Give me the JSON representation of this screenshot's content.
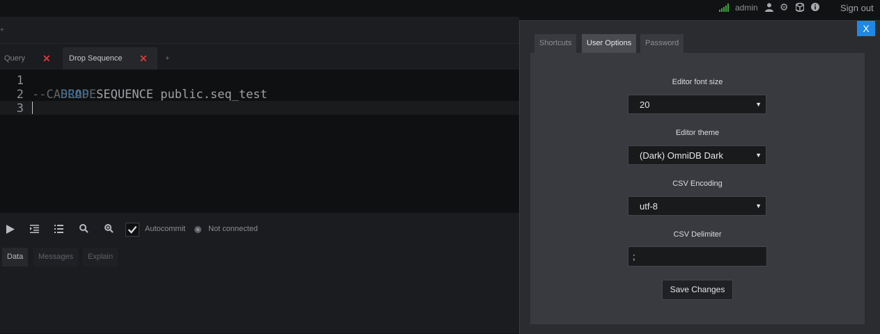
{
  "topbar": {
    "username": "admin",
    "signout_label": "Sign out",
    "icons": [
      "signal-icon",
      "user-icon",
      "gear-icon",
      "cube-icon",
      "info-icon"
    ]
  },
  "conn_strip": {
    "add_label": "+"
  },
  "query_tabs": {
    "tabs": [
      {
        "label": "Query",
        "close": "✕"
      },
      {
        "label": "Drop Sequence",
        "close": "✕"
      }
    ],
    "add_label": "+"
  },
  "editor": {
    "lines": [
      {
        "num": "1",
        "keyword": "DROP",
        "text": " SEQUENCE public.seq_test"
      },
      {
        "num": "2",
        "comment": "--CASCADE"
      },
      {
        "num": "3",
        "text": ""
      }
    ]
  },
  "toolbar": {
    "autocommit_label": "Autocommit",
    "status": "Not connected",
    "icons": [
      "play-icon",
      "indent-icon",
      "list-icon",
      "search-icon",
      "zoom-in-icon"
    ]
  },
  "results_tabs": [
    "Data",
    "Messages",
    "Explain"
  ],
  "modal": {
    "close_label": "X",
    "tabs": [
      "Shortcuts",
      "User Options",
      "Password"
    ],
    "active_tab": "User Options",
    "font_size_label": "Editor font size",
    "font_size_value": "20",
    "theme_label": "Editor theme",
    "theme_value": "(Dark) OmniDB Dark",
    "csv_encoding_label": "CSV Encoding",
    "csv_encoding_value": "utf-8",
    "csv_delimiter_label": "CSV Delimiter",
    "csv_delimiter_value": ";",
    "save_label": "Save Changes"
  },
  "colors": {
    "accent": "#1e88e5",
    "signal": "#3ea83b",
    "close_x": "#d23b3b",
    "keyword": "#2f7bbd"
  }
}
